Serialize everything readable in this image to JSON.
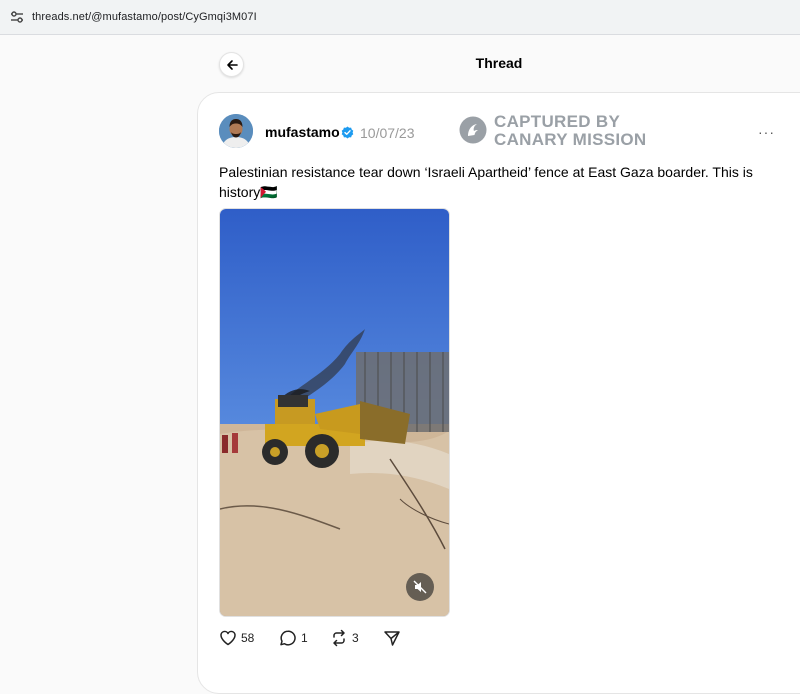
{
  "browser": {
    "url": "threads.net/@mufastamo/post/CyGmqi3M07I"
  },
  "header": {
    "title": "Thread"
  },
  "post": {
    "username": "mufastamo",
    "date": "10/07/23",
    "text": "Palestinian resistance tear down ‘Israeli Apartheid’ fence at East Gaza boarder. This is history🇵🇸",
    "more": "···",
    "stats": {
      "likes": "58",
      "replies": "1",
      "reposts": "3"
    }
  },
  "watermark": {
    "line1": "CAPTURED BY",
    "line2": "CANARY MISSION"
  },
  "icons": {
    "site_info": "site-info-icon",
    "back": "arrow-left-icon",
    "verified": "verified-badge-icon",
    "watermark": "canary-mission-logo-icon",
    "mute": "muted-speaker-icon",
    "like": "heart-icon",
    "reply": "speech-bubble-icon",
    "repost": "repost-icon",
    "share": "send-icon"
  },
  "colors": {
    "verified": "#1d9bf0",
    "watermark": "#9aa0a6",
    "date": "#9a9a9a"
  }
}
